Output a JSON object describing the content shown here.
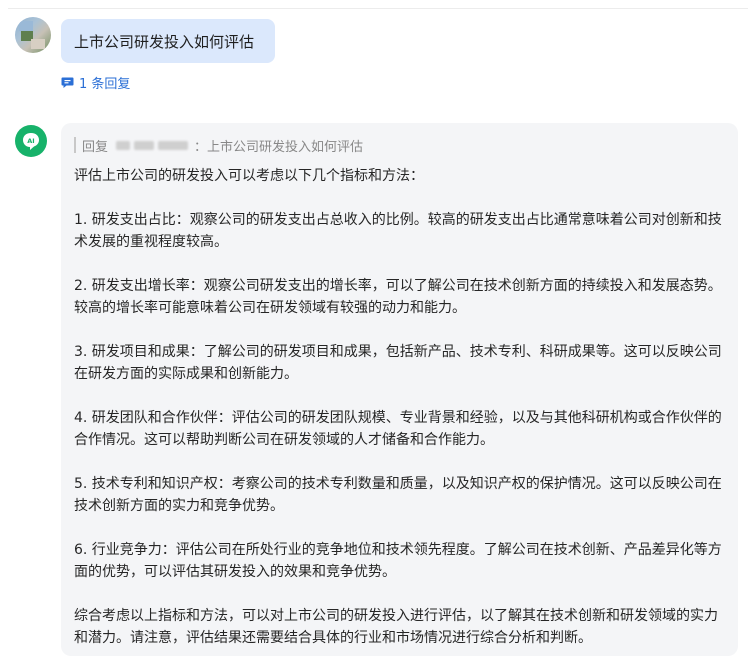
{
  "question": {
    "text": "上市公司研发投入如何评估"
  },
  "reply_count_label": "1 条回复",
  "answer": {
    "quote_prefix": "回复",
    "quote_text": "：上市公司研发投入如何评估",
    "paragraphs": [
      "评估上市公司的研发投入可以考虑以下几个指标和方法：",
      "1. 研发支出占比：观察公司的研发支出占总收入的比例。较高的研发支出占比通常意味着公司对创新和技术发展的重视程度较高。",
      "2. 研发支出增长率：观察公司研发支出的增长率，可以了解公司在技术创新方面的持续投入和发展态势。较高的增长率可能意味着公司在研发领域有较强的动力和能力。",
      "3. 研发项目和成果：了解公司的研发项目和成果，包括新产品、技术专利、科研成果等。这可以反映公司在研发方面的实际成果和创新能力。",
      "4. 研发团队和合作伙伴：评估公司的研发团队规模、专业背景和经验，以及与其他科研机构或合作伙伴的合作情况。这可以帮助判断公司在研发领域的人才储备和合作能力。",
      "5. 技术专利和知识产权：考察公司的技术专利数量和质量，以及知识产权的保护情况。这可以反映公司在技术创新方面的实力和竞争优势。",
      "6. 行业竞争力：评估公司在所处行业的竞争地位和技术领先程度。了解公司在技术创新、产品差异化等方面的优势，可以评估其研发投入的效果和竞争优势。",
      "综合考虑以上指标和方法，可以对上市公司的研发投入进行评估，以了解其在技术创新和研发领域的实力和潜力。请注意，评估结果还需要结合具体的行业和市场情况进行综合分析和判断。"
    ]
  },
  "icons": {
    "reply": "comment-icon",
    "ai": "ai-bot-icon"
  },
  "colors": {
    "question_bubble": "#dbe8fc",
    "link": "#2b6fd6",
    "ai_badge": "#17b26a",
    "answer_bg": "#f4f5f7"
  }
}
